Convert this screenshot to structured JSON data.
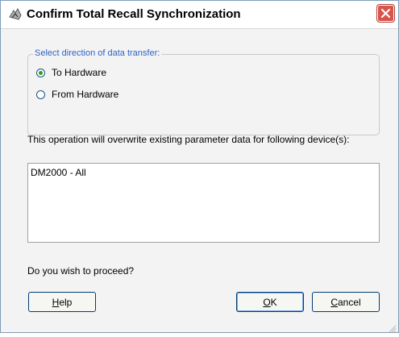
{
  "window": {
    "title": "Confirm Total Recall Synchronization"
  },
  "transfer_group": {
    "legend": "Select direction of data transfer:",
    "options": [
      {
        "label": "To Hardware",
        "checked": true
      },
      {
        "label": "From Hardware",
        "checked": false
      }
    ]
  },
  "overwrite_message": "This operation will overwrite existing parameter data for following device(s):",
  "devices": [
    "DM2000 - All"
  ],
  "proceed_question": "Do you wish to proceed?",
  "buttons": {
    "help": {
      "mnemonic": "H",
      "rest": "elp"
    },
    "ok": {
      "mnemonic": "O",
      "rest": "K"
    },
    "cancel": {
      "mnemonic": "C",
      "rest": "ancel"
    }
  },
  "icons": {
    "title": "total-recall-icon",
    "close": "close-icon",
    "grip": "size-grip-icon"
  },
  "colors": {
    "legend_text": "#2d64c8",
    "close_button": "#d9534a",
    "radio_dot": "#22a222"
  }
}
